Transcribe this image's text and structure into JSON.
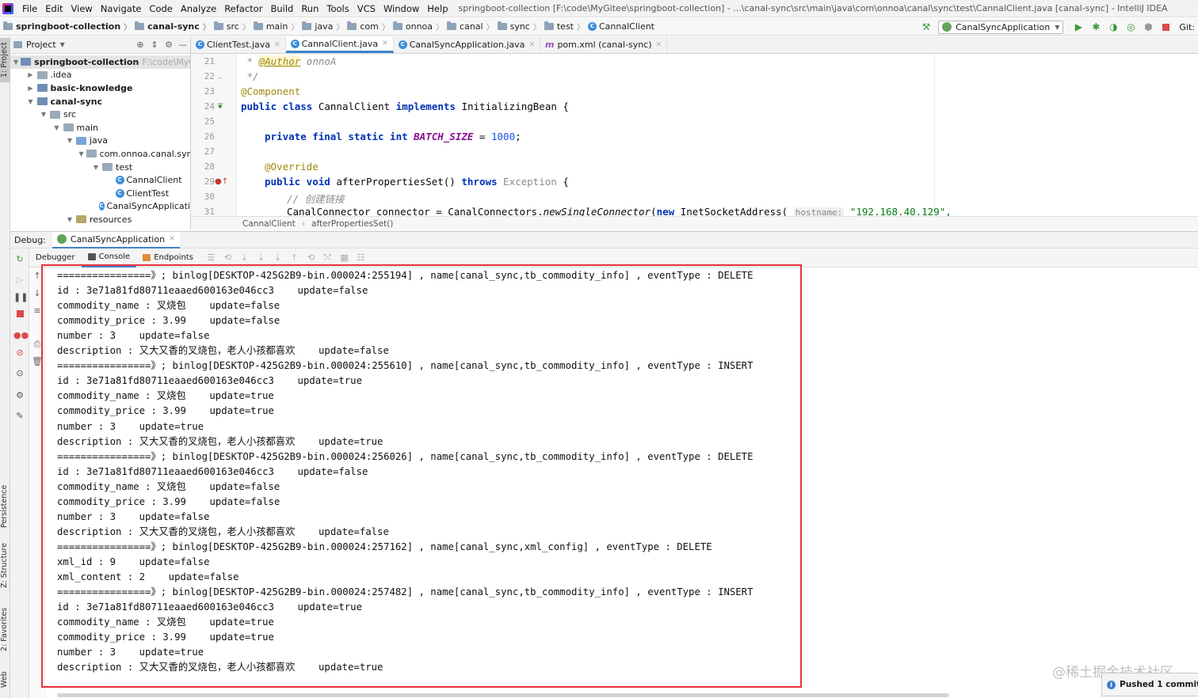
{
  "menubar": {
    "items": [
      "File",
      "Edit",
      "View",
      "Navigate",
      "Code",
      "Analyze",
      "Refactor",
      "Build",
      "Run",
      "Tools",
      "VCS",
      "Window",
      "Help"
    ],
    "window_title": "springboot-collection [F:\\code\\MyGitee\\springboot-collection] - ...\\canal-sync\\src\\main\\java\\com\\onnoa\\canal\\sync\\test\\CannalClient.java [canal-sync] - IntelliJ IDEA"
  },
  "navbar": {
    "crumbs": [
      "springboot-collection",
      "canal-sync",
      "src",
      "main",
      "java",
      "com",
      "onnoa",
      "canal",
      "sync",
      "test",
      "CannalClient"
    ],
    "run_config": "CanalSyncApplication",
    "git_label": "Git:"
  },
  "sidebar_tabs": {
    "project": "1: Project",
    "persistence": "Persistence",
    "structure": "Z: Structure",
    "favorites": "2: Favorites",
    "web": "Web"
  },
  "project": {
    "header_label": "Project",
    "tree": [
      {
        "label": "springboot-collection",
        "hint": "F:\\code\\MyGitee",
        "depth": 0,
        "arrow": "▼",
        "kind": "mod",
        "bold": true
      },
      {
        "label": ".idea",
        "depth": 1,
        "arrow": "▶",
        "kind": "folder"
      },
      {
        "label": "basic-knowledge",
        "depth": 1,
        "arrow": "▶",
        "kind": "mod",
        "bold": true
      },
      {
        "label": "canal-sync",
        "depth": 1,
        "arrow": "▼",
        "kind": "mod",
        "bold": true
      },
      {
        "label": "src",
        "depth": 2,
        "arrow": "▼",
        "kind": "folder"
      },
      {
        "label": "main",
        "depth": 3,
        "arrow": "▼",
        "kind": "folder"
      },
      {
        "label": "java",
        "depth": 4,
        "arrow": "▼",
        "kind": "src"
      },
      {
        "label": "com.onnoa.canal.sync",
        "depth": 5,
        "arrow": "▼",
        "kind": "folder"
      },
      {
        "label": "test",
        "depth": 6,
        "arrow": "▼",
        "kind": "folder"
      },
      {
        "label": "CannalClient",
        "depth": 7,
        "arrow": "",
        "kind": "class"
      },
      {
        "label": "ClientTest",
        "depth": 7,
        "arrow": "",
        "kind": "class"
      },
      {
        "label": "CanalSyncApplicati",
        "depth": 6,
        "arrow": "",
        "kind": "class"
      },
      {
        "label": "resources",
        "depth": 4,
        "arrow": "▼",
        "kind": "res"
      }
    ]
  },
  "editor": {
    "tabs": [
      {
        "label": "ClientTest.java",
        "icon": "class",
        "active": false
      },
      {
        "label": "CannalClient.java",
        "icon": "class",
        "active": true
      },
      {
        "label": "CanalSyncApplication.java",
        "icon": "class",
        "active": false
      },
      {
        "label": "pom.xml (canal-sync)",
        "icon": "maven",
        "active": false
      }
    ],
    "line_numbers": [
      "21",
      "22",
      "23",
      "24",
      "25",
      "26",
      "27",
      "28",
      "29",
      "30",
      "31"
    ],
    "code": {
      "l21_star": " * ",
      "l21_tag": "@Author",
      "l21_rest": " onnoA",
      "l22": " */",
      "l23": "@Component",
      "l24_kw": "public class",
      "l24_name": " CannalClient ",
      "l24_kw2": "implements",
      "l24_rest": " InitializingBean {",
      "l26_kw": "private final static int",
      "l26_const": "BATCH_SIZE",
      "l26_eq": " = ",
      "l26_num": "1000",
      "l26_end": ";",
      "l28": "@Override",
      "l29_kw": "public void",
      "l29_name": " afterPropertiesSet() ",
      "l29_kw2": "throws",
      "l29_exc": " Exception",
      "l29_end": " {",
      "l30": "// 创建链接",
      "l31_a": "CanalConnector connector = CanalConnectors.",
      "l31_m": "newSingleConnector",
      "l31_b": "(",
      "l31_kw": "new",
      "l31_c": " InetSocketAddress( ",
      "l31_hint": "hostname:",
      "l31_str": " \"192.168.40.129\","
    },
    "breadcrumb": [
      "CannalClient",
      "afterPropertiesSet()"
    ]
  },
  "debug": {
    "label": "Debug:",
    "tab": "CanalSyncApplication",
    "subtabs": [
      "Debugger",
      "Console",
      "Endpoints"
    ]
  },
  "console": {
    "lines": [
      "================》; binlog[DESKTOP-425G2B9-bin.000024:255194] , name[canal_sync,tb_commodity_info] , eventType : DELETE",
      "id : 3e71a81fd80711eaaed600163e046cc3    update=false",
      "commodity_name : 叉烧包    update=false",
      "commodity_price : 3.99    update=false",
      "number : 3    update=false",
      "description : 又大又香的叉烧包，老人小孩都喜欢    update=false",
      "================》; binlog[DESKTOP-425G2B9-bin.000024:255610] , name[canal_sync,tb_commodity_info] , eventType : INSERT",
      "id : 3e71a81fd80711eaaed600163e046cc3    update=true",
      "commodity_name : 叉烧包    update=true",
      "commodity_price : 3.99    update=true",
      "number : 3    update=true",
      "description : 又大又香的叉烧包，老人小孩都喜欢    update=true",
      "================》; binlog[DESKTOP-425G2B9-bin.000024:256026] , name[canal_sync,tb_commodity_info] , eventType : DELETE",
      "id : 3e71a81fd80711eaaed600163e046cc3    update=false",
      "commodity_name : 叉烧包    update=false",
      "commodity_price : 3.99    update=false",
      "number : 3    update=false",
      "description : 又大又香的叉烧包，老人小孩都喜欢    update=false",
      "================》; binlog[DESKTOP-425G2B9-bin.000024:257162] , name[canal_sync,xml_config] , eventType : DELETE",
      "xml_id : 9    update=false",
      "xml_content : 2    update=false",
      "================》; binlog[DESKTOP-425G2B9-bin.000024:257482] , name[canal_sync,tb_commodity_info] , eventType : INSERT",
      "id : 3e71a81fd80711eaaed600163e046cc3    update=true",
      "commodity_name : 叉烧包    update=true",
      "commodity_price : 3.99    update=true",
      "number : 3    update=true",
      "description : 又大又香的叉烧包，老人小孩都喜欢    update=true"
    ]
  },
  "watermark": "@稀土掘金技术社区",
  "notification": "Pushed 1 commit to",
  "colors": {
    "highlight_box": "#e8323b",
    "accent": "#4083c9"
  }
}
